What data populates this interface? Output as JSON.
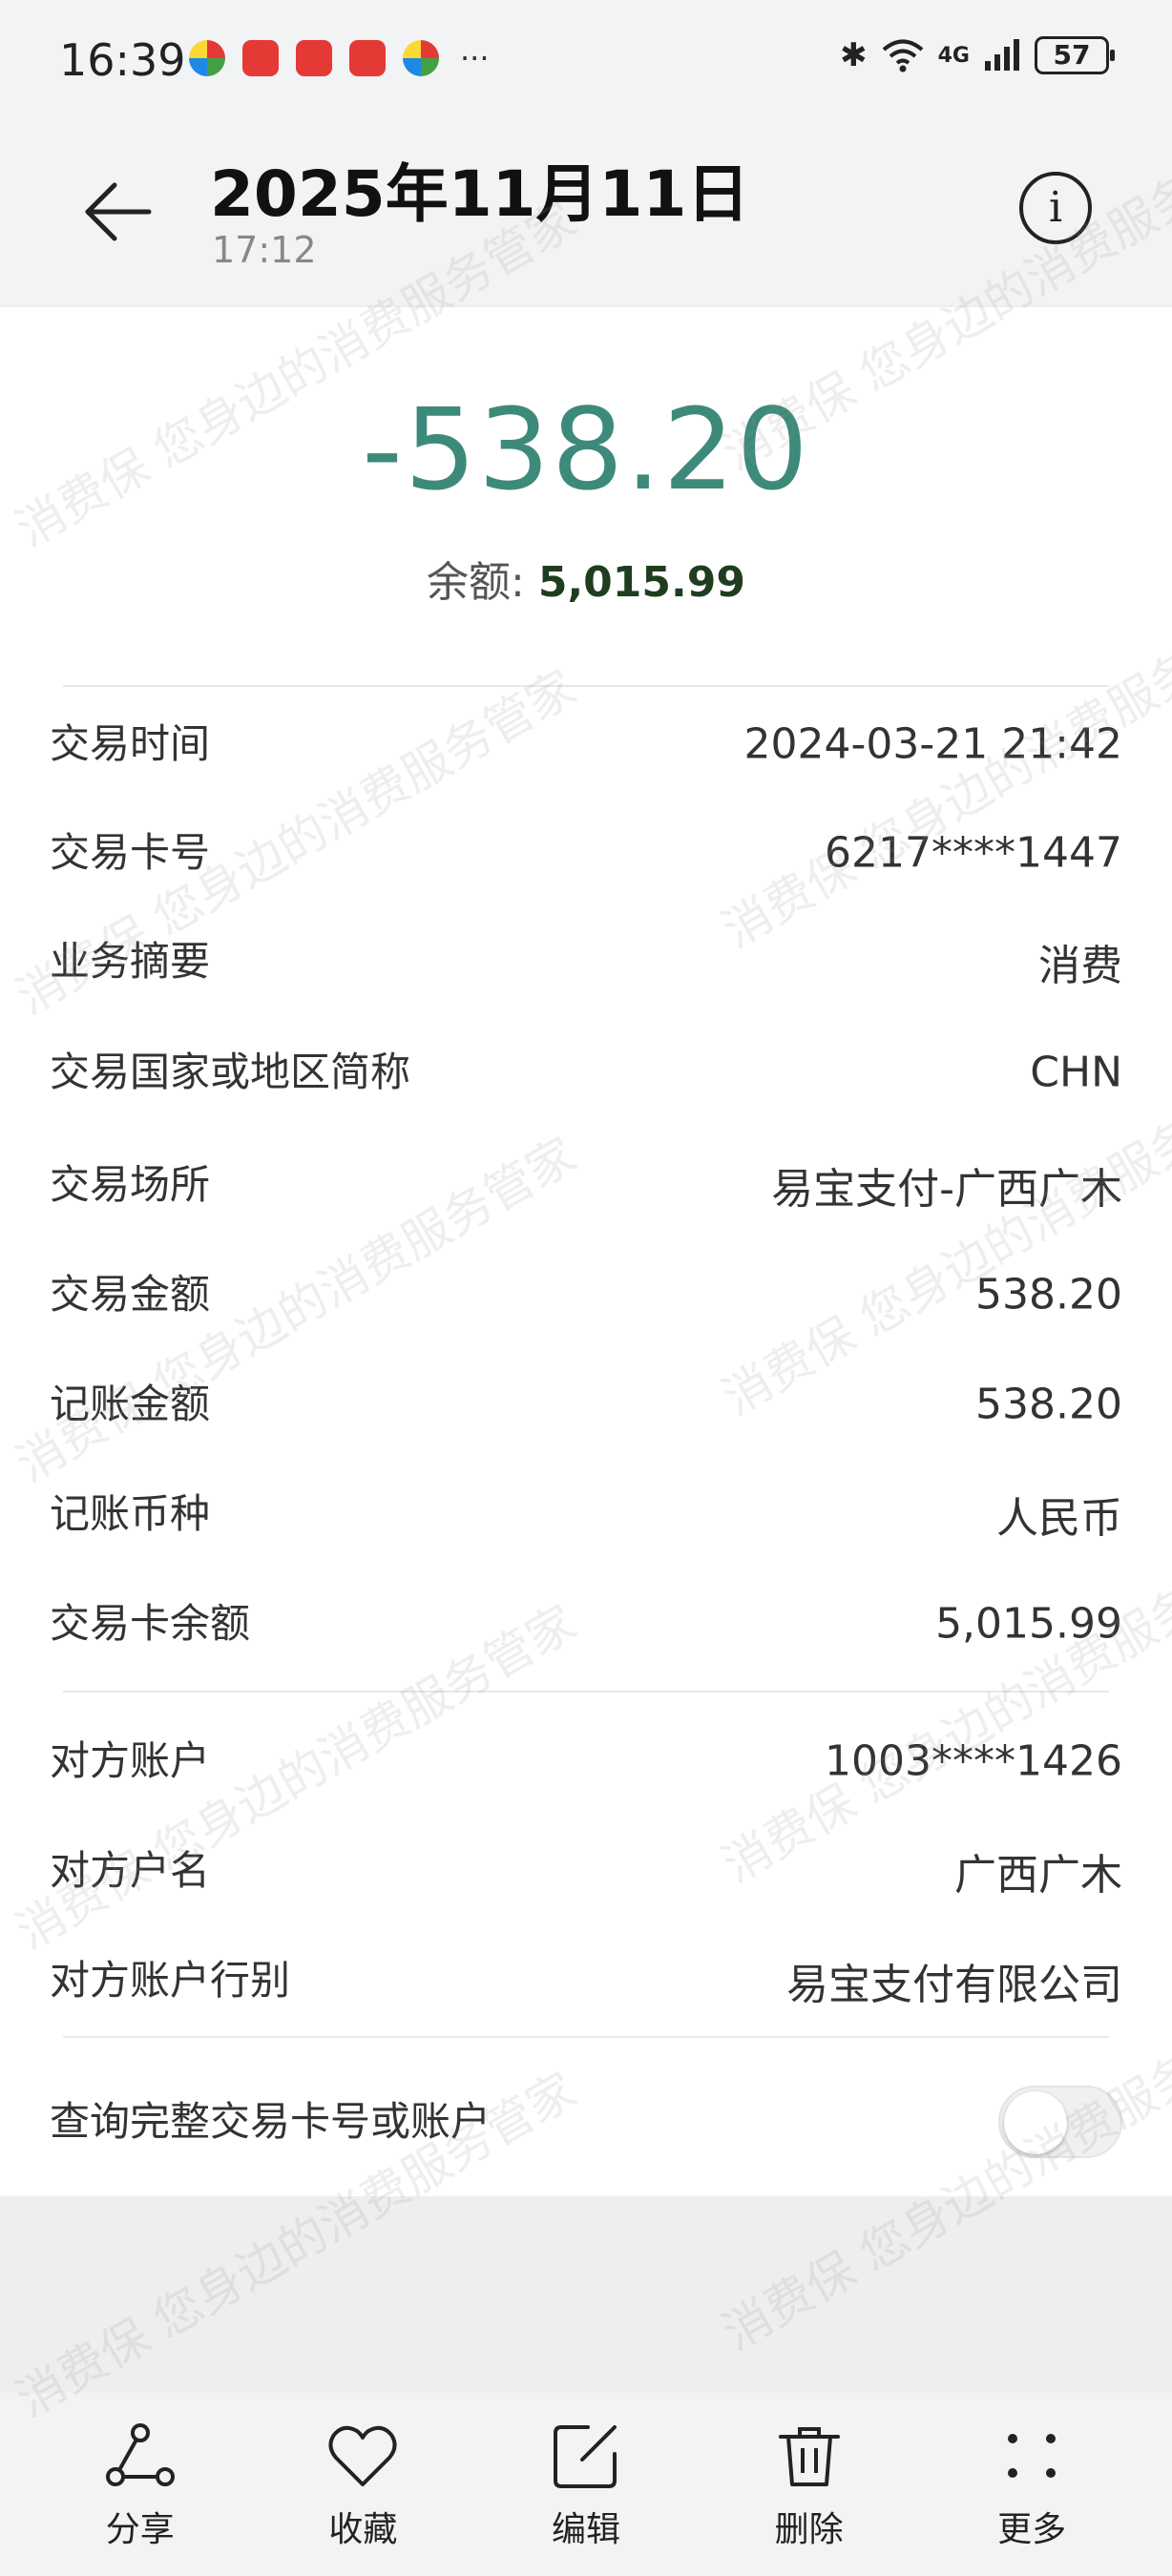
{
  "status_bar": {
    "time": "16:39",
    "more": "···",
    "bluetooth": "✱",
    "wifi": "wifi-6",
    "network": "4G",
    "battery": "57"
  },
  "header": {
    "title": "2025年11月11日",
    "subtitle": "17:12"
  },
  "summary": {
    "amount": "-538.20",
    "balance_label": "余额: ",
    "balance_value": "5,015.99"
  },
  "details": [
    {
      "label": "交易时间",
      "value": "2024-03-21 21:42"
    },
    {
      "label": "交易卡号",
      "value": "6217****1447"
    },
    {
      "label": "业务摘要",
      "value": "消费"
    },
    {
      "label": "交易国家或地区简称",
      "value": "CHN"
    },
    {
      "label": "交易场所",
      "value": "易宝支付-广西广木"
    },
    {
      "label": "交易金额",
      "value": "538.20"
    },
    {
      "label": "记账金额",
      "value": "538.20"
    },
    {
      "label": "记账币种",
      "value": "人民币"
    },
    {
      "label": "交易卡余额",
      "value": "5,015.99"
    }
  ],
  "counterparty": [
    {
      "label": "对方账户",
      "value": "1003****1426"
    },
    {
      "label": "对方户名",
      "value": "广西广木"
    },
    {
      "label": "对方账户行别",
      "value": "易宝支付有限公司"
    }
  ],
  "query_toggle": {
    "label": "查询完整交易卡号或账户",
    "enabled": false
  },
  "toolbar": {
    "share": "分享",
    "favorite": "收藏",
    "edit": "编辑",
    "delete": "删除",
    "more": "更多"
  },
  "watermark": "消费保 您身边的消费服务管家",
  "colors": {
    "amount": "#3d8a7a",
    "balance_value": "#1f3d1f"
  }
}
